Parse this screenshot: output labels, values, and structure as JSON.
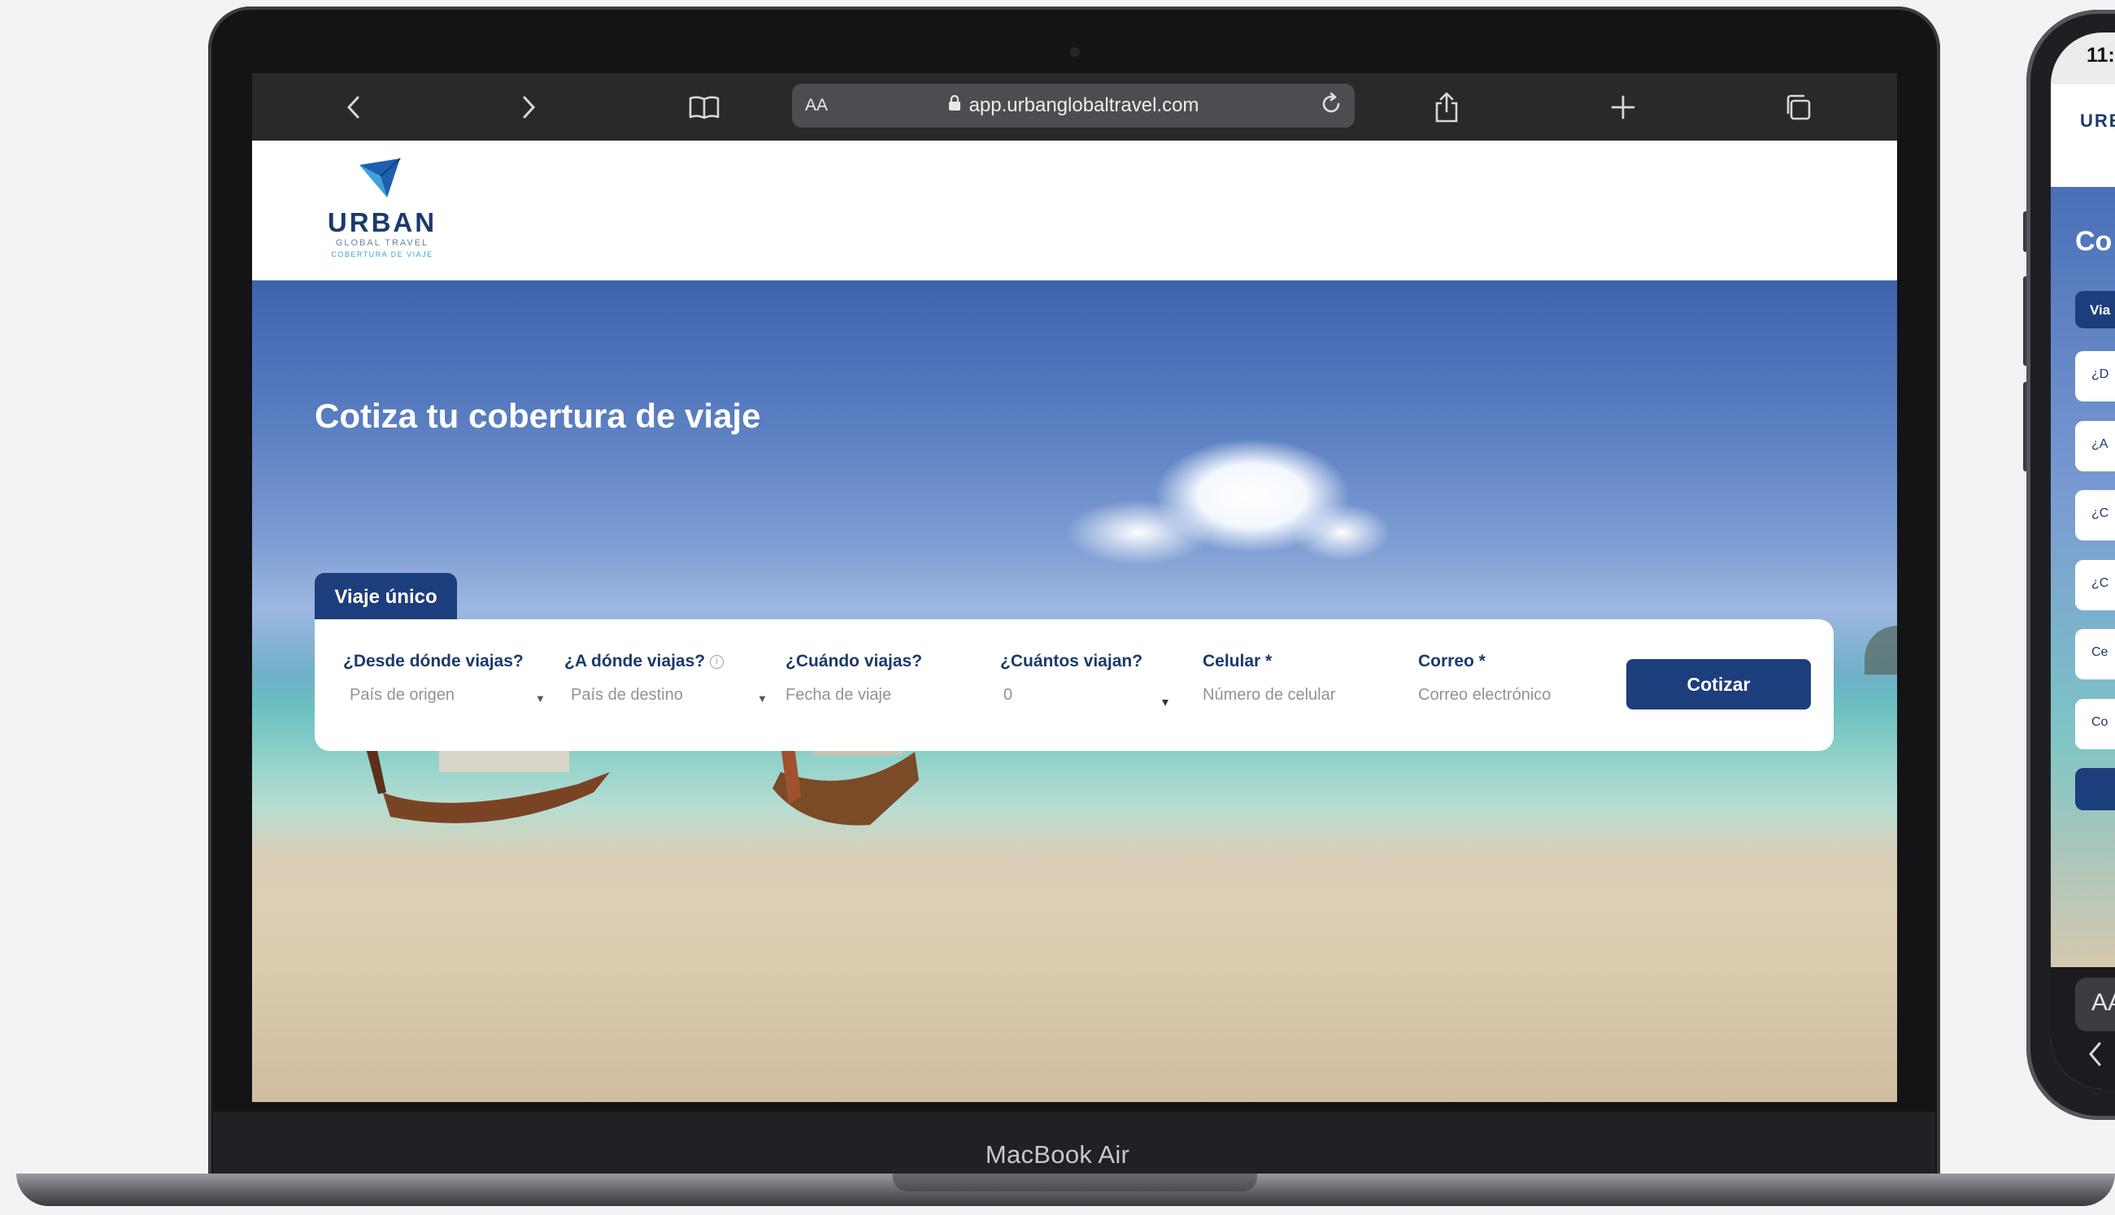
{
  "device": {
    "laptop_label": "MacBook Air"
  },
  "browser": {
    "text_size_label": "AA",
    "url": "app.urbanglobaltravel.com"
  },
  "site": {
    "logo": {
      "name": "URBAN",
      "line1": "GLOBAL TRAVEL",
      "line2": "COBERTURA DE VIAJE"
    },
    "hero_title": "Cotiza tu cobertura de viaje",
    "tab_label": "Viaje único",
    "form": {
      "origin": {
        "label": "¿Desde dónde viajas?",
        "placeholder": "País de origen"
      },
      "destination": {
        "label": "¿A dónde viajas?",
        "placeholder": "País de destino"
      },
      "date": {
        "label": "¿Cuándo viajas?",
        "placeholder": "Fecha de viaje"
      },
      "travelers": {
        "label": "¿Cuántos viajan?",
        "value": "0"
      },
      "phone": {
        "label": "Celular *",
        "placeholder": "Número de celular"
      },
      "email": {
        "label": "Correo *",
        "placeholder": "Correo electrónico"
      },
      "submit_label": "Cotizar"
    }
  },
  "phone": {
    "time": "11:",
    "logo": "URB",
    "title": "Co",
    "tab": "Via",
    "fields": [
      "¿D",
      "¿A",
      "¿C",
      "¿C",
      "Ce",
      "Co"
    ],
    "text_size_label": "AA"
  },
  "colors": {
    "brand_navy": "#1d3e7c",
    "accent_blue": "#3fa3d8",
    "toolbar": "#28292b"
  }
}
